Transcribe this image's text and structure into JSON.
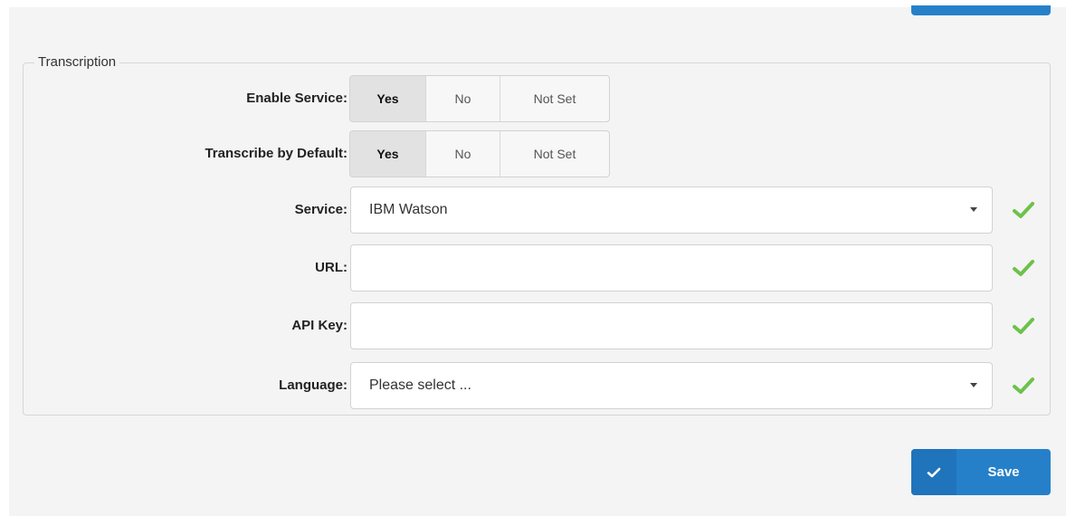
{
  "section": {
    "legend": "Transcription"
  },
  "fields": {
    "enable_service": {
      "label": "Enable Service:",
      "options": [
        "Yes",
        "No",
        "Not Set"
      ],
      "selected": "Yes"
    },
    "transcribe_default": {
      "label": "Transcribe by Default:",
      "options": [
        "Yes",
        "No",
        "Not Set"
      ],
      "selected": "Yes"
    },
    "service": {
      "label": "Service:",
      "value": "IBM Watson"
    },
    "url": {
      "label": "URL:",
      "value": ""
    },
    "api_key": {
      "label": "API Key:",
      "value": ""
    },
    "language": {
      "label": "Language:",
      "value": "Please select ..."
    }
  },
  "actions": {
    "save_label": "Save"
  },
  "colors": {
    "accent": "#2680c9",
    "valid": "#6cc24a"
  },
  "icons": {
    "valid": "check-icon",
    "save": "check-icon",
    "dropdown": "caret-down-icon"
  }
}
